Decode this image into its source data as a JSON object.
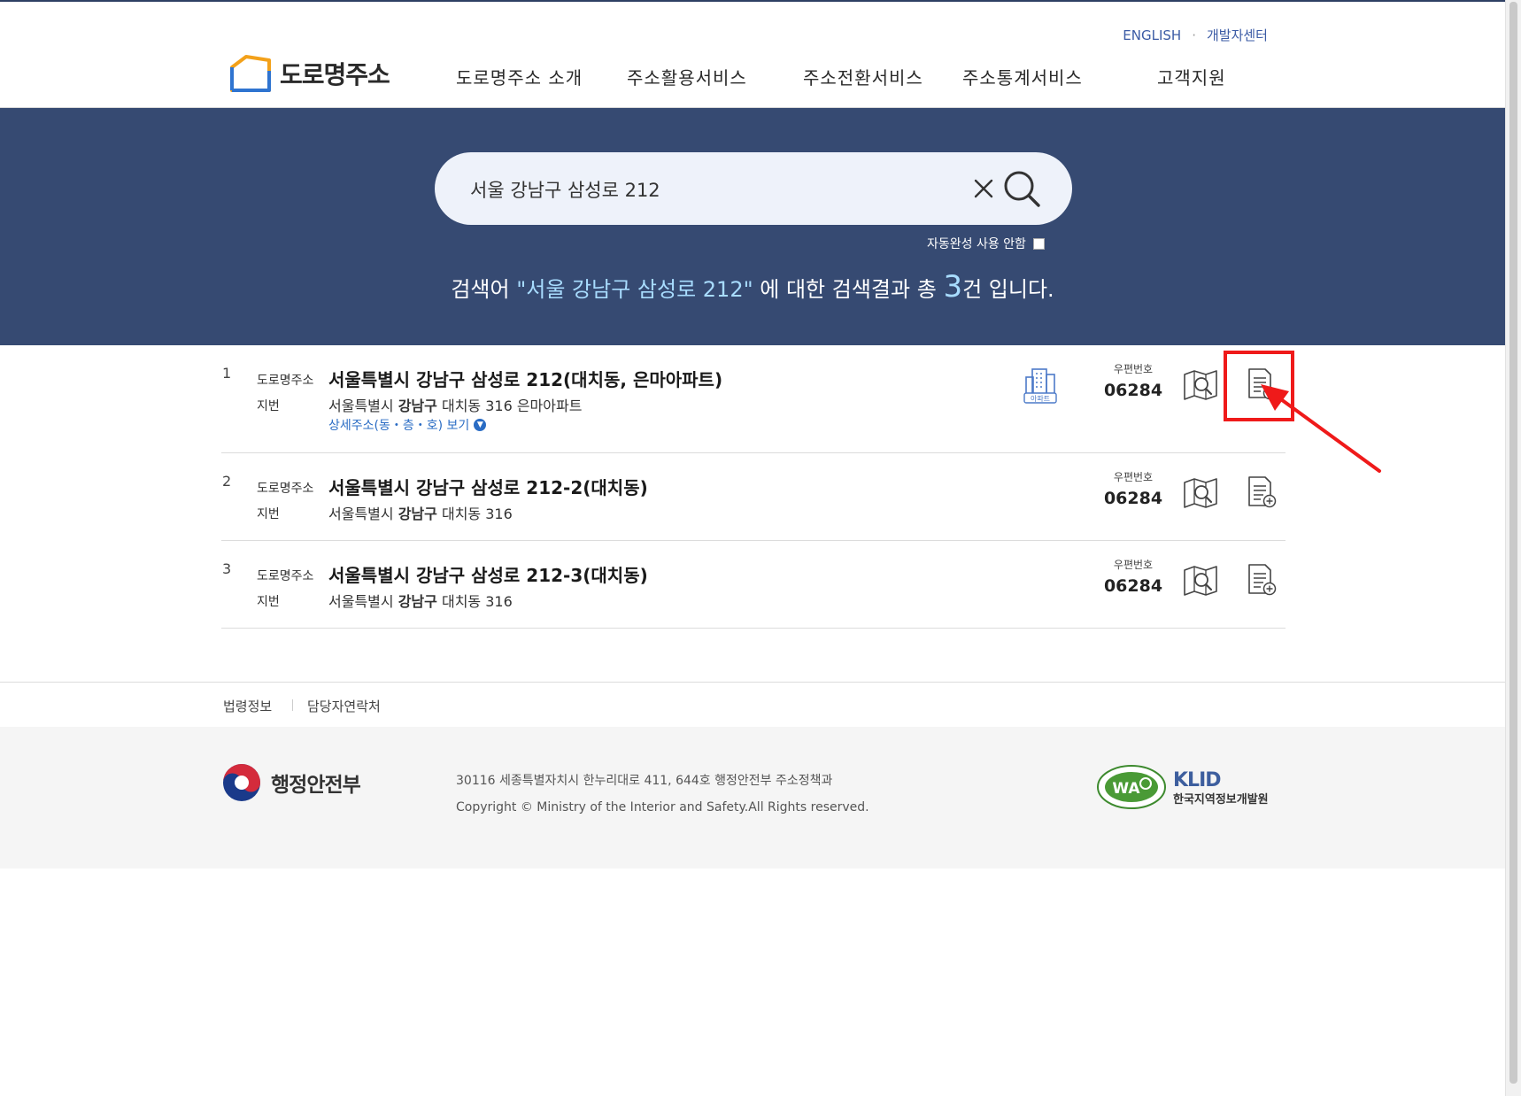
{
  "header": {
    "util_links": [
      "ENGLISH",
      "개발자센터"
    ],
    "logo_text": "도로명주소",
    "nav": [
      "도로명주소 소개",
      "주소활용서비스",
      "주소전환서비스",
      "주소통계서비스",
      "고객지원"
    ]
  },
  "search": {
    "query": "서울 강남구 삼성로 212",
    "autocomplete_label": "자동완성 사용 안함"
  },
  "result_message": {
    "prefix": "검색어 ",
    "query": "\"서울 강남구 삼성로 212\"",
    "middle": " 에 대한 검색결과 총 ",
    "count": "3",
    "suffix": "건 입니다."
  },
  "results": [
    {
      "index": "1",
      "road_label": "도로명주소",
      "road_address": "서울특별시 강남구 삼성로 212(대치동, 은마아파트)",
      "jibun_label": "지번",
      "jibun_city": "서울특별시",
      "jibun_gu": "강남구",
      "jibun_rest": "대치동 316 은마아파트",
      "detail_link": "상세주소(동・층・호) 보기",
      "building_type": "아파트",
      "zip_label": "우편번호",
      "zip": "06284"
    },
    {
      "index": "2",
      "road_label": "도로명주소",
      "road_address": "서울특별시 강남구 삼성로 212-2(대치동)",
      "jibun_label": "지번",
      "jibun_city": "서울특별시",
      "jibun_gu": "강남구",
      "jibun_rest": "대치동 316",
      "zip_label": "우편번호",
      "zip": "06284"
    },
    {
      "index": "3",
      "road_label": "도로명주소",
      "road_address": "서울특별시 강남구 삼성로 212-3(대치동)",
      "jibun_label": "지번",
      "jibun_city": "서울특별시",
      "jibun_gu": "강남구",
      "jibun_rest": "대치동 316",
      "zip_label": "우편번호",
      "zip": "06284"
    }
  ],
  "footer": {
    "links": [
      "법령정보",
      "담당자연락처"
    ],
    "ministry": "행정안전부",
    "address": "30116 세종특별자치시 한누리대로 411, 644호 행정안전부 주소정책과",
    "copyright": "Copyright © Ministry of the Interior and Safety.All Rights reserved.",
    "wa_mark": "WA",
    "klid_logo": "KLID",
    "klid_name": "한국지역정보개발원"
  },
  "colors": {
    "hero_bg": "#364a72",
    "highlight": "#ef1a1a",
    "link_blue": "#2a6cc4"
  }
}
